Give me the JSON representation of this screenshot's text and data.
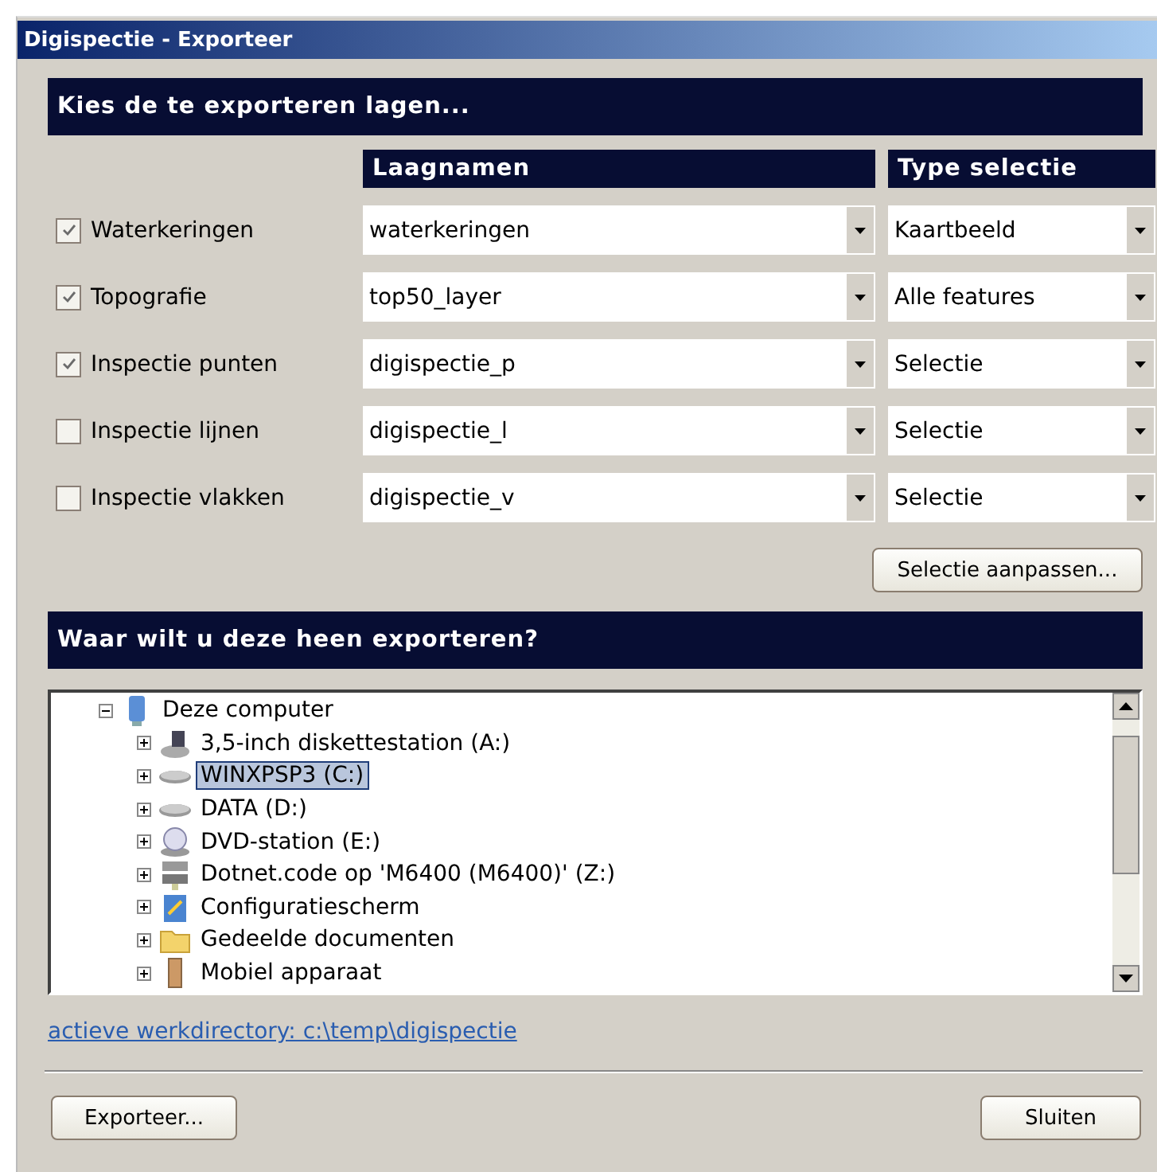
{
  "window": {
    "title": "Digispectie - Exporteer"
  },
  "layers_section": {
    "title": "Kies de te exporteren lagen...",
    "columns": [
      "Laagnamen",
      "Type selectie"
    ],
    "rows": [
      {
        "label": "Waterkeringen",
        "checked": true,
        "layer": "waterkeringen",
        "type": "Kaartbeeld"
      },
      {
        "label": "Topografie",
        "checked": true,
        "layer": "top50_layer",
        "type": "Alle features"
      },
      {
        "label": "Inspectie punten",
        "checked": true,
        "layer": "digispectie_p",
        "type": "Selectie"
      },
      {
        "label": "Inspectie lijnen",
        "checked": false,
        "layer": "digispectie_l",
        "type": "Selectie"
      },
      {
        "label": "Inspectie vlakken",
        "checked": false,
        "layer": "digispectie_v",
        "type": "Selectie"
      }
    ],
    "button": "Selectie aanpassen..."
  },
  "export_section": {
    "title": "Waar wilt u deze heen exporteren?",
    "tree": [
      {
        "label": "Deze computer",
        "kind": "computer",
        "expanded": true,
        "selected": false,
        "children": [
          {
            "label": "3,5-inch diskettestation (A:)",
            "kind": "floppy",
            "expanded": false,
            "selected": false
          },
          {
            "label": "WINXPSP3 (C:)",
            "kind": "drive",
            "expanded": false,
            "selected": true
          },
          {
            "label": "DATA (D:)",
            "kind": "drive",
            "expanded": false,
            "selected": false
          },
          {
            "label": "DVD-station (E:)",
            "kind": "dvd",
            "expanded": false,
            "selected": false
          },
          {
            "label": "Dotnet.code op 'M6400 (M6400)' (Z:)",
            "kind": "network",
            "expanded": false,
            "selected": false
          },
          {
            "label": "Configuratiescherm",
            "kind": "control",
            "expanded": false,
            "selected": false
          },
          {
            "label": "Gedeelde documenten",
            "kind": "folder",
            "expanded": false,
            "selected": false
          },
          {
            "label": "Mobiel apparaat",
            "kind": "mobile",
            "expanded": false,
            "selected": false
          }
        ]
      }
    ]
  },
  "link": "actieve werkdirectory: c:\\temp\\digispectie",
  "buttons": [
    "Exporteer...",
    "Sluiten"
  ]
}
